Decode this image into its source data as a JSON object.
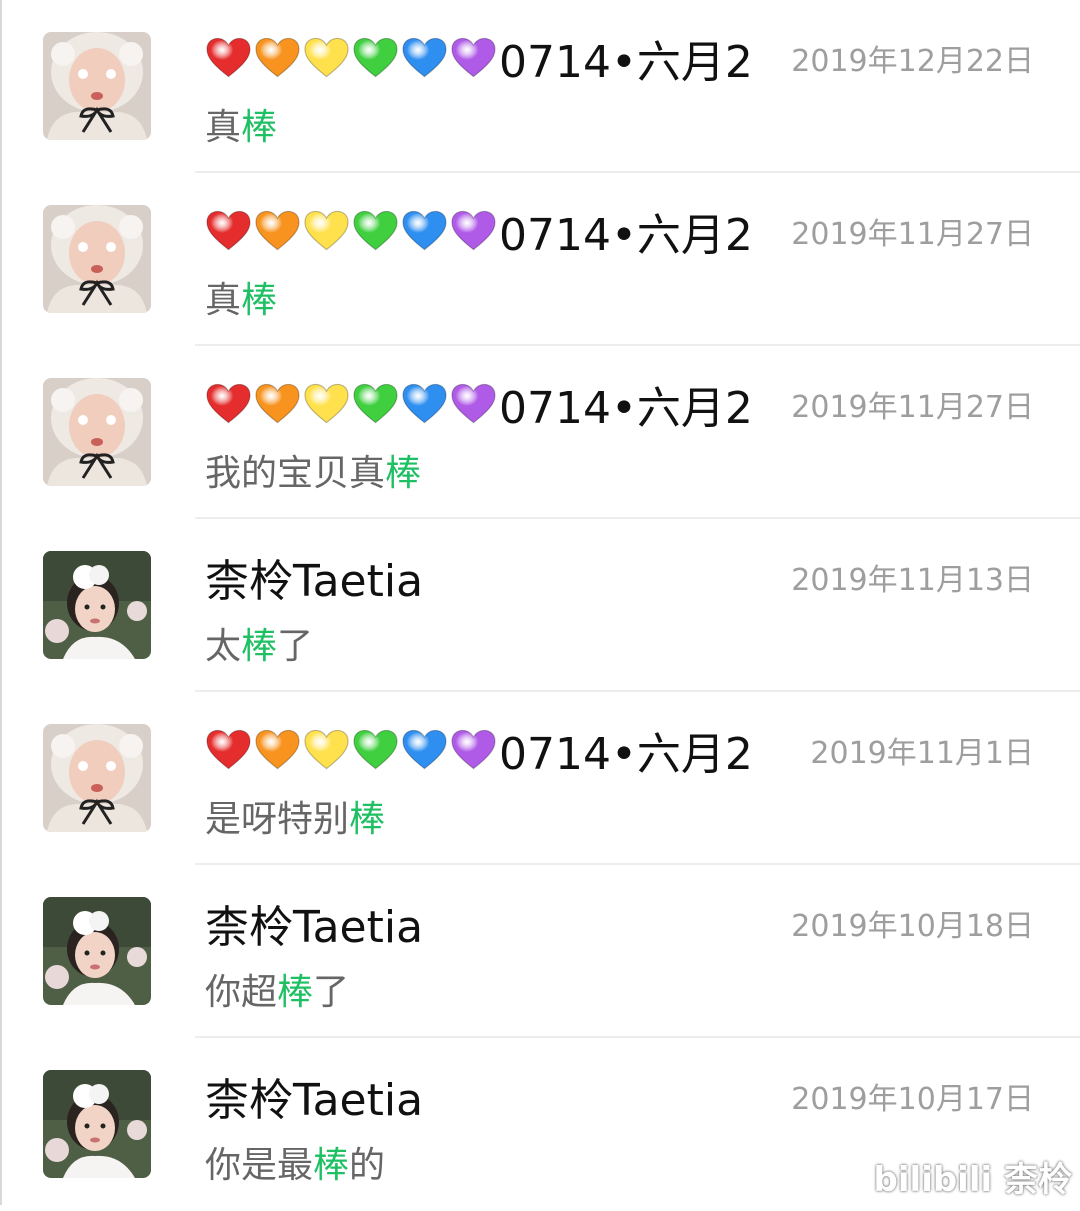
{
  "colors": {
    "highlight": "#1fbf63",
    "date": "#9e9e9e",
    "message": "#666666",
    "name": "#111111",
    "separator": "#ededed"
  },
  "heart_colors": [
    "#e52d2d",
    "#f7931e",
    "#ffe14d",
    "#3fcf3f",
    "#2f8ff0",
    "#b05be8"
  ],
  "items": [
    {
      "avatar": "avatar-photo-a",
      "hearts": true,
      "name": "0714•六月2",
      "date": "2019年12月22日",
      "msg_before": "真",
      "msg_highlight": "棒",
      "msg_after": ""
    },
    {
      "avatar": "avatar-photo-a",
      "hearts": true,
      "name": "0714•六月2",
      "date": "2019年11月27日",
      "msg_before": "真",
      "msg_highlight": "棒",
      "msg_after": ""
    },
    {
      "avatar": "avatar-photo-a",
      "hearts": true,
      "name": "0714•六月2",
      "date": "2019年11月27日",
      "msg_before": "我的宝贝真",
      "msg_highlight": "棒",
      "msg_after": ""
    },
    {
      "avatar": "avatar-photo-b",
      "hearts": false,
      "name": "柰柃Taetia",
      "date": "2019年11月13日",
      "msg_before": "太",
      "msg_highlight": "棒",
      "msg_after": "了"
    },
    {
      "avatar": "avatar-photo-a",
      "hearts": true,
      "name": "0714•六月2",
      "date": "2019年11月1日",
      "msg_before": "是呀特别",
      "msg_highlight": "棒",
      "msg_after": ""
    },
    {
      "avatar": "avatar-photo-b",
      "hearts": false,
      "name": "柰柃Taetia",
      "date": "2019年10月18日",
      "msg_before": "你超",
      "msg_highlight": "棒",
      "msg_after": "了"
    },
    {
      "avatar": "avatar-photo-b",
      "hearts": false,
      "name": "柰柃Taetia",
      "date": "2019年10月17日",
      "msg_before": "你是最",
      "msg_highlight": "棒",
      "msg_after": "的"
    }
  ],
  "watermark": "bilibili 柰柃"
}
